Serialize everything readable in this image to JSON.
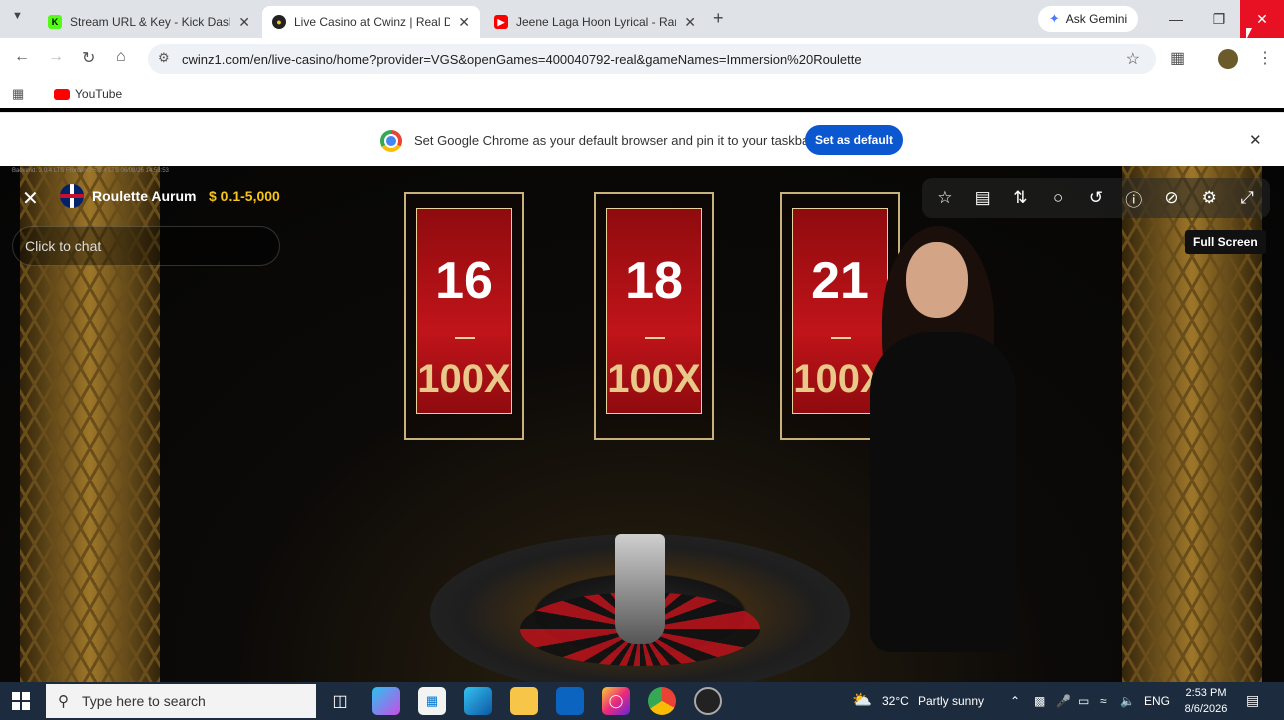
{
  "browser": {
    "tabs": [
      {
        "title": "Stream URL & Key - Kick Dashb",
        "icon": "kick-icon",
        "active": false
      },
      {
        "title": "Live Casino at Cwinz | Real Dea",
        "icon": "cwinz-icon",
        "active": true
      },
      {
        "title": "Jeene Laga Hoon Lyrical - Ram",
        "icon": "youtube-icon",
        "active": false
      }
    ],
    "gemini_label": "Ask Gemini",
    "url": "cwinz1.com/en/live-casino/home?provider=VGS&openGames=400040792-real&gameNames=Immersion%20Roulette",
    "bookmarks": [
      {
        "label": "YouTube",
        "icon": "youtube-icon"
      }
    ]
  },
  "infobar": {
    "text": "Set Google Chrome as your default browser and pin it to your taskbar",
    "button": "Set as default"
  },
  "game": {
    "title": "Roulette Aurum",
    "limits": "$ 0.1-5,000",
    "chat_placeholder": "Click to chat",
    "tooltip": "Full Screen",
    "version_text": "Backend: 3.0.4 LTS  Frontend: 5.0.4 LTS  06/08/26 14:53:53",
    "lucky_numbers": [
      {
        "number": "16",
        "multiplier": "100X"
      },
      {
        "number": "18",
        "multiplier": "100X"
      },
      {
        "number": "21",
        "multiplier": "100X"
      }
    ],
    "toolbar_icons": [
      "favorite-star-icon",
      "statistics-icon",
      "sort-icon",
      "chat-bubbles-icon",
      "history-icon",
      "info-icon",
      "video-off-icon",
      "settings-icon",
      "fullscreen-icon"
    ]
  },
  "taskbar": {
    "search_placeholder": "Type here to search",
    "weather": {
      "temp": "32°C",
      "condition": "Partly sunny"
    },
    "language": "ENG",
    "time": "2:53 PM",
    "date": "8/6/2026"
  }
}
